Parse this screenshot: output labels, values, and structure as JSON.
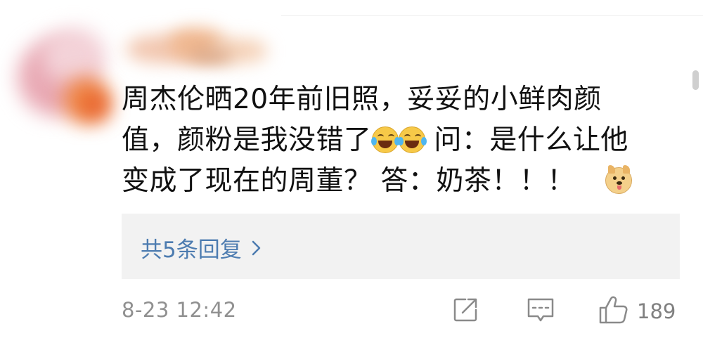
{
  "comment": {
    "lines": [
      "周杰伦晒20年前旧照，妥妥的小鲜肉颜",
      "值，颜粉是我没错了",
      " 问：是什么让他",
      "变成了现在的周董？ 答：奶茶！！！ "
    ],
    "emoji_laugh": "laughing-tears-emoji",
    "emoji_doge": "doge-emoji"
  },
  "replies": {
    "label": "共5条回复",
    "icon": "chevron-right-icon",
    "color": "#4d7cb0"
  },
  "meta": {
    "timestamp": "8-23 12:42",
    "like_count": "189",
    "share_icon": "share-icon",
    "reply_icon": "comment-icon",
    "like_icon": "thumbs-up-icon"
  },
  "colors": {
    "text": "#111111",
    "secondary": "#909090",
    "reply_box_bg": "#f2f2f2"
  }
}
